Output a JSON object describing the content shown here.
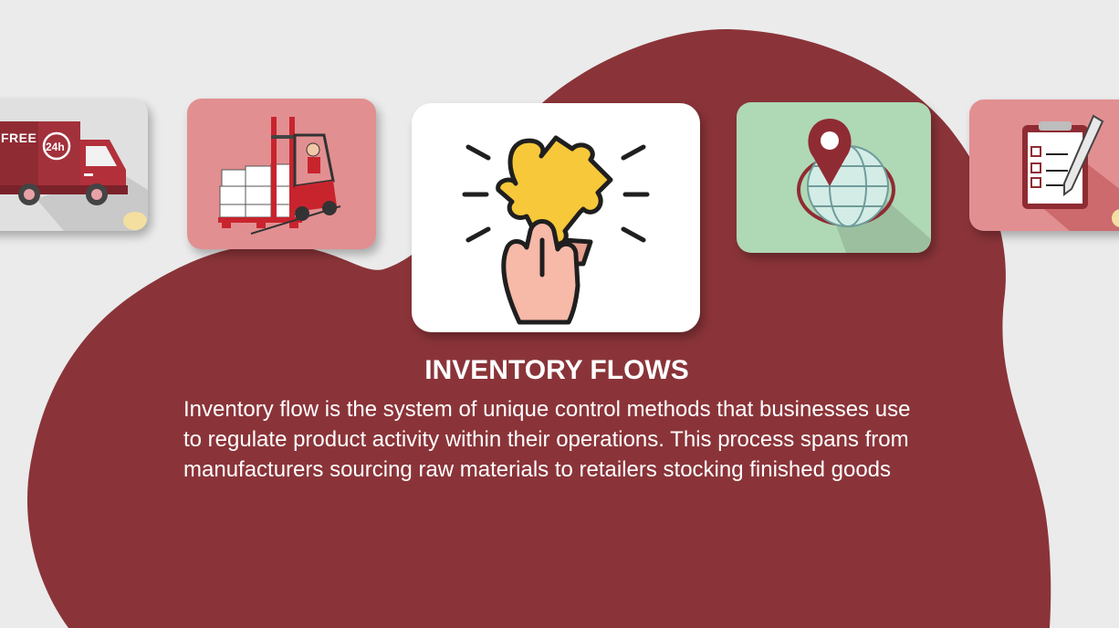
{
  "slide": {
    "title": "INVENTORY FLOWS",
    "body": "Inventory flow is the system of unique control methods that businesses use to regulate product activity within their operations. This process spans from manufacturers sourcing raw materials to retailers stocking finished goods"
  },
  "cards": [
    {
      "icon": "delivery-truck-icon",
      "badge_text": "FREE",
      "clock_text": "24h",
      "color": "#e0e0e0"
    },
    {
      "icon": "forklift-icon",
      "color": "#e28f91"
    },
    {
      "icon": "puzzle-hand-icon",
      "color": "#ffffff"
    },
    {
      "icon": "globe-location-pin-icon",
      "color": "#afd8b5"
    },
    {
      "icon": "checklist-clipboard-icon",
      "color": "#e28f91"
    }
  ],
  "colors": {
    "background": "#ebebeb",
    "blob": "#8a3439",
    "accent_red": "#8f2b33",
    "puzzle_yellow": "#f6c83a"
  }
}
